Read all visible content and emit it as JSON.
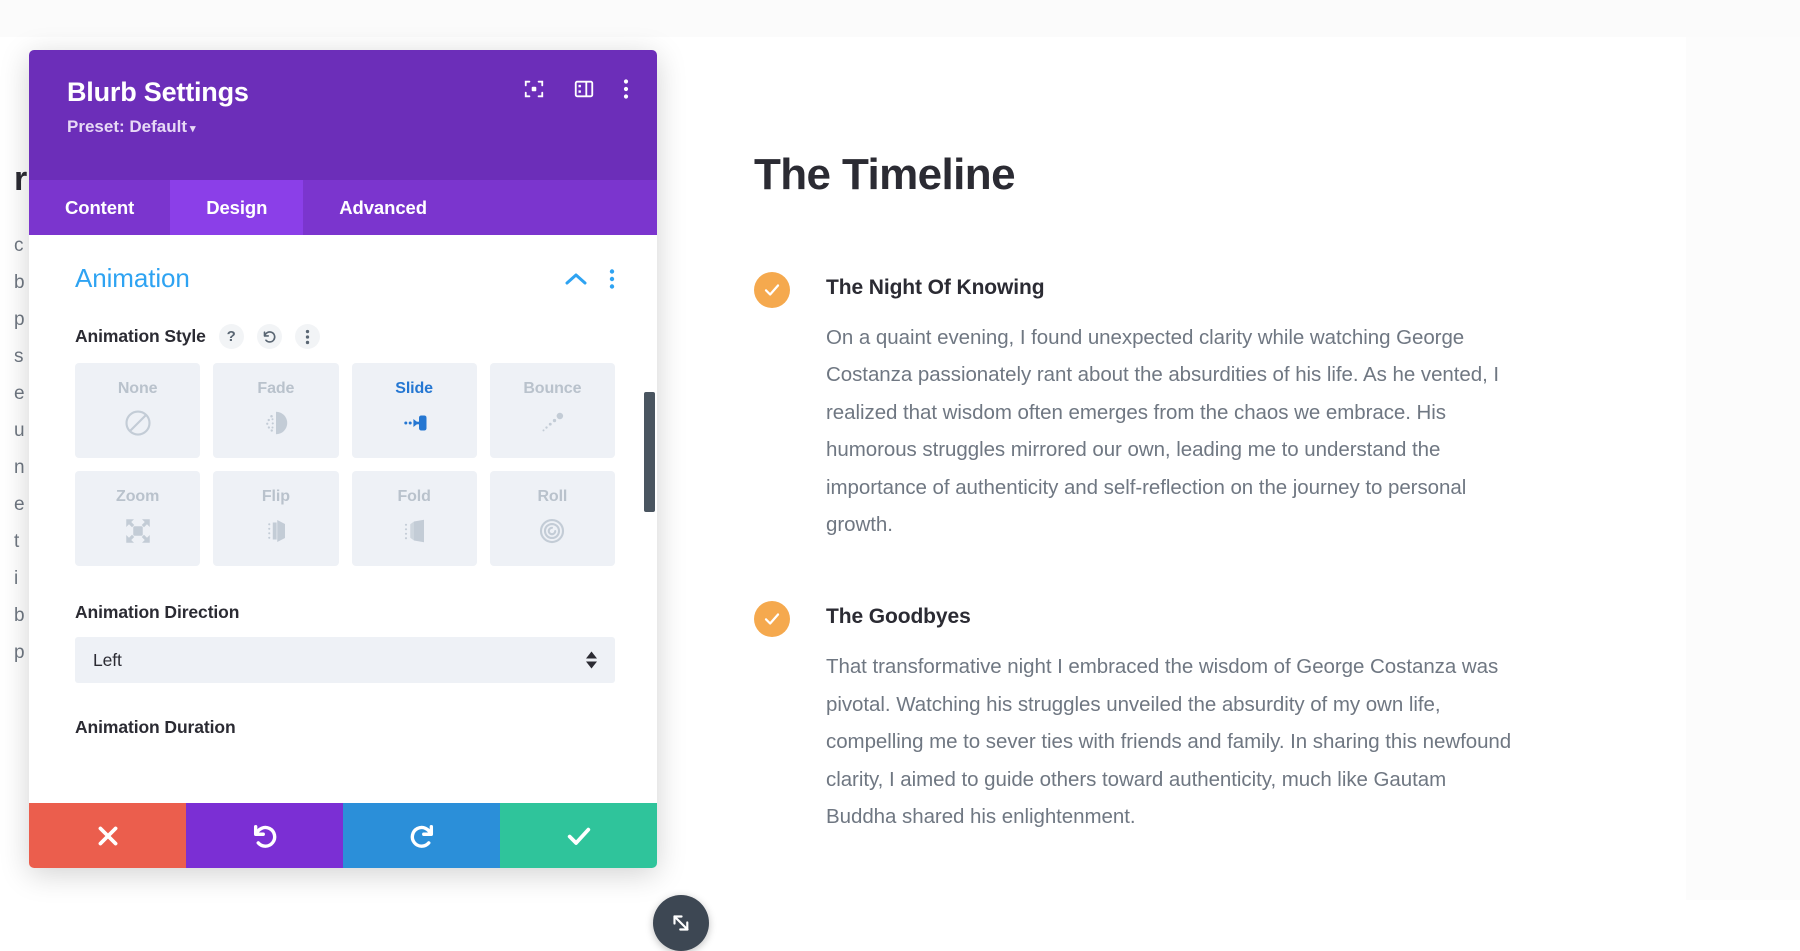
{
  "modal": {
    "title": "Blurb Settings",
    "preset_label": "Preset: Default",
    "preset_caret": "▾",
    "header_icons": [
      {
        "name": "fullscreen-icon"
      },
      {
        "name": "layout-panel-icon"
      },
      {
        "name": "more-vertical-icon"
      }
    ],
    "tabs": [
      {
        "label": "Content",
        "active": false
      },
      {
        "label": "Design",
        "active": true
      },
      {
        "label": "Advanced",
        "active": false
      }
    ],
    "section": {
      "title": "Animation",
      "collapse_icon": "chevron-up-icon",
      "more_icon": "more-vertical-icon"
    },
    "animation_style": {
      "label": "Animation Style",
      "help_glyph": "?",
      "reset_icon": "undo-icon",
      "more_icon": "more-vertical-icon",
      "options": [
        {
          "label": "None",
          "icon": "no-entry-icon",
          "selected": false
        },
        {
          "label": "Fade",
          "icon": "fade-icon",
          "selected": false
        },
        {
          "label": "Slide",
          "icon": "slide-icon",
          "selected": true
        },
        {
          "label": "Bounce",
          "icon": "bounce-icon",
          "selected": false
        },
        {
          "label": "Zoom",
          "icon": "zoom-expand-icon",
          "selected": false
        },
        {
          "label": "Flip",
          "icon": "flip-icon",
          "selected": false
        },
        {
          "label": "Fold",
          "icon": "fold-icon",
          "selected": false
        },
        {
          "label": "Roll",
          "icon": "roll-spiral-icon",
          "selected": false
        }
      ]
    },
    "animation_direction": {
      "label": "Animation Direction",
      "value": "Left"
    },
    "animation_duration": {
      "label": "Animation Duration"
    },
    "footer_buttons": [
      {
        "name": "cancel-button",
        "icon": "close-x-icon"
      },
      {
        "name": "undo-button",
        "icon": "undo-icon"
      },
      {
        "name": "redo-button",
        "icon": "redo-icon"
      },
      {
        "name": "save-button",
        "icon": "check-icon"
      }
    ],
    "resize_handle_icon": "resize-diagonal-icon",
    "colors": {
      "header_purple": "#6C2EB9",
      "tab_active_purple": "#8B3FE8",
      "tab_bar_purple": "#7B35CE",
      "section_blue": "#2EA3F2",
      "selected_blue": "#2577D2",
      "cancel_red": "#eb5e4d",
      "undo_purple": "#7B2FD4",
      "redo_blue": "#2B8FD9",
      "save_green": "#2fc49b",
      "icon_orange": "#f5a94e"
    }
  },
  "content": {
    "title": "The Timeline",
    "blurbs": [
      {
        "icon": "check-circle-icon",
        "title": "The Night Of Knowing",
        "text": "On a quaint evening, I found unexpected clarity while watching George Costanza passionately rant about the absurdities of his life. As he vented, I realized that wisdom often emerges from the chaos we embrace. His humorous struggles mirrored our own, leading me to understand the importance of authenticity and self-reflection on the journey to personal growth."
      },
      {
        "icon": "check-circle-icon",
        "title": "The Goodbyes",
        "text": "That transformative night I embraced the wisdom of George Costanza was pivotal. Watching his struggles unveiled the absurdity of my own life, compelling me to sever ties with friends and family. In sharing this newfound clarity, I aimed to guide others toward authenticity, much like Gautam Buddha shared his enlightenment."
      }
    ]
  },
  "obscured": {
    "heading": "r",
    "lines": [
      "c",
      "b",
      "p",
      "s",
      "e",
      "u",
      "n",
      "",
      "e",
      "t",
      "i",
      "b",
      "p"
    ]
  }
}
